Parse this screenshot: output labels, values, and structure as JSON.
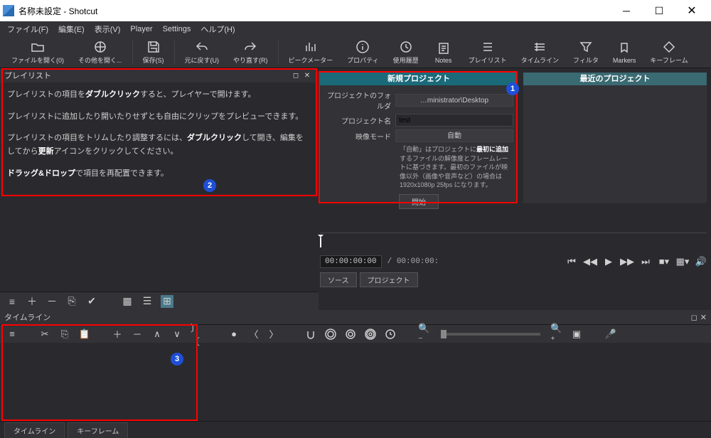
{
  "window": {
    "title": "名称未設定 - Shotcut"
  },
  "menu": {
    "file": "ファイル(F)",
    "edit": "編集(E)",
    "view": "表示(V)",
    "player": "Player",
    "settings": "Settings",
    "help": "ヘルプ(H)"
  },
  "toolbar": {
    "open": "ファイルを開く(0)",
    "open_other": "その他を開く...",
    "save": "保存(S)",
    "undo": "元に戻す(U)",
    "redo": "やり直す(R)",
    "peak_meter": "ピークメーター",
    "properties": "プロパティ",
    "history": "使用履歴",
    "notes": "Notes",
    "playlist": "プレイリスト",
    "timeline": "タイムライン",
    "filter": "フィルタ",
    "markers": "Markers",
    "keyframe": "キーフレーム"
  },
  "playlist": {
    "title": "プレイリスト",
    "help1_a": "プレイリストの項目を",
    "help1_b": "ダブルクリック",
    "help1_c": "すると、プレイヤーで開けます。",
    "help2": "プレイリストに追加したり開いたりせずとも自由にクリップをプレビューできます。",
    "help3_a": "プレイリストの項目をトリムしたり調整するには、",
    "help3_b": "ダブルクリック",
    "help3_c": "して開き、編集をしてから",
    "help3_d": "更新",
    "help3_e": "アイコンをクリックしてください。",
    "help4_a": "ドラッグ&ドロップ",
    "help4_b": "で項目を再配置できます。"
  },
  "project": {
    "new_title": "新規プロジェクト",
    "recent_title": "最近のプロジェクト",
    "folder_lbl": "プロジェクトのフォルダ",
    "folder_val": "…ministrator\\Desktop",
    "name_lbl": "プロジェクト名",
    "name_val": "test",
    "mode_lbl": "映像モード",
    "mode_val": "自動",
    "desc_a": "「自動」はプロジェクトに",
    "desc_b": "最初に追加",
    "desc_c": "するファイルの解像度とフレームレートに基づきます。最初のファイルが映像以外（画像や音声など）の場合は 1920x1080p 25fps になります。",
    "start": "開始"
  },
  "transport": {
    "tc_in": "00:00:00:00",
    "tc_dur": "/ 00:00:00:"
  },
  "source_tabs": {
    "source": "ソース",
    "project": "プロジェクト"
  },
  "timeline": {
    "title": "タイムライン"
  },
  "bottom_tabs": {
    "timeline": "タイムライン",
    "keyframe": "キーフレーム"
  },
  "badges": {
    "b1": "1",
    "b2": "2",
    "b3": "3"
  }
}
